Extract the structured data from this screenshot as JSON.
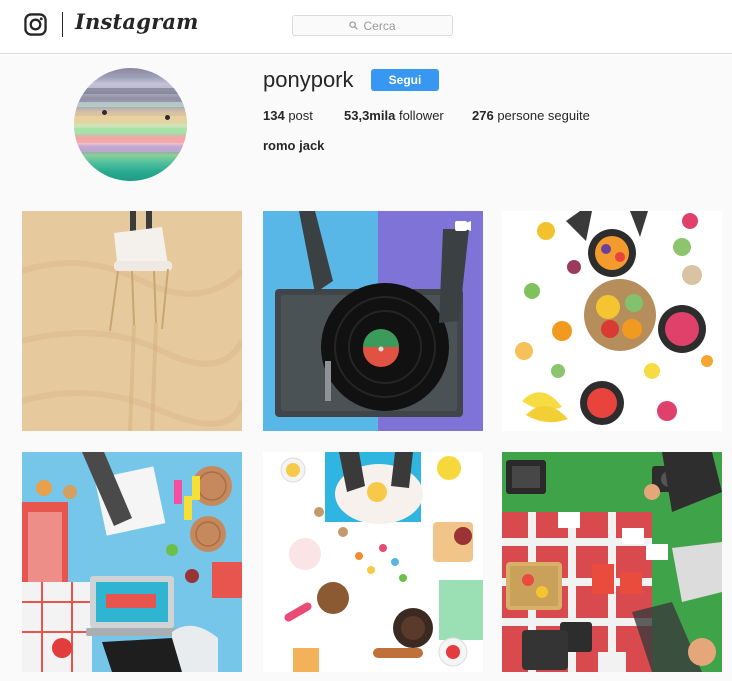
{
  "nav": {
    "wordmark": "Instagram",
    "search_placeholder": "Cerca"
  },
  "profile": {
    "username": "ponypork",
    "follow_label": "Segui",
    "stats": {
      "posts_count": "134",
      "posts_label": "post",
      "followers_count": "53,3mila",
      "followers_label": "follower",
      "following_count": "276",
      "following_label": "persone seguite"
    },
    "full_name": "romo jack"
  },
  "colors": {
    "accent": "#3897f0",
    "text": "#262626",
    "background": "#fafafa",
    "border": "#dbdbdb"
  },
  "posts": [
    {
      "subject": "white chair on sand"
    },
    {
      "subject": "record player with vinyl",
      "badge": "video-icon"
    },
    {
      "subject": "fruit bowls flat lay"
    },
    {
      "subject": "desk with laptop flat lay"
    },
    {
      "subject": "baking flat lay"
    },
    {
      "subject": "picnic on grass"
    }
  ]
}
